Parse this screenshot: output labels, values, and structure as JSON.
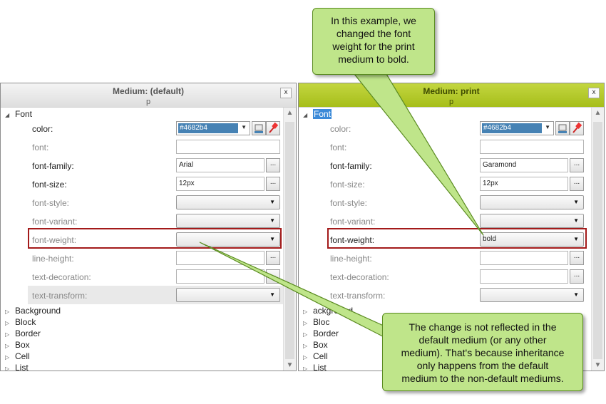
{
  "left": {
    "title": "Medium: (default)",
    "subtitle": "p",
    "close": "x",
    "group_font": "Font",
    "color_value": "#4682b4",
    "props": {
      "color": "color:",
      "font": "font:",
      "family": "font-family:",
      "size": "font-size:",
      "style": "font-style:",
      "variant": "font-variant:",
      "weight": "font-weight:",
      "line": "line-height:",
      "deco": "text-decoration:",
      "transform": "text-transform:"
    },
    "values": {
      "family": "Arial",
      "size": "12px"
    },
    "groups": [
      "Background",
      "Block",
      "Border",
      "Box",
      "Cell",
      "List"
    ]
  },
  "right": {
    "title": "Medium: print",
    "subtitle": "p",
    "close": "x",
    "group_font": "Font",
    "color_value": "#4682b4",
    "props": {
      "color": "color:",
      "font": "font:",
      "family": "font-family:",
      "size": "font-size:",
      "style": "font-style:",
      "variant": "font-variant:",
      "weight": "font-weight:",
      "line": "line-height:",
      "deco": "text-decoration:",
      "transform": "text-transform:"
    },
    "values": {
      "family": "Garamond",
      "size": "12px",
      "weight": "bold"
    },
    "groups": [
      "Background",
      "Block",
      "Border",
      "Box",
      "Cell",
      "List"
    ],
    "groups_visible": [
      "ackground",
      "Bloc",
      "Border",
      "Box",
      "Cell",
      "List"
    ]
  },
  "ellipsis": "...",
  "callouts": {
    "top": [
      "In this example, we",
      "changed the font",
      "weight for the print",
      "medium to bold."
    ],
    "bottom": [
      "The change is not reflected in the",
      "default medium (or any other",
      "medium). That's because inheritance",
      "only happens from the default",
      "medium to the non-default mediums."
    ]
  },
  "colors": {
    "accent_header": "#a6be1a",
    "highlight": "#a31a1a",
    "callout": "#bfe58a",
    "swatch": "#4682b4"
  },
  "icons": [
    "color-picker-icon",
    "pin-icon",
    "expand-triangle-icon",
    "collapse-triangle-icon",
    "dropdown-caret-icon"
  ]
}
